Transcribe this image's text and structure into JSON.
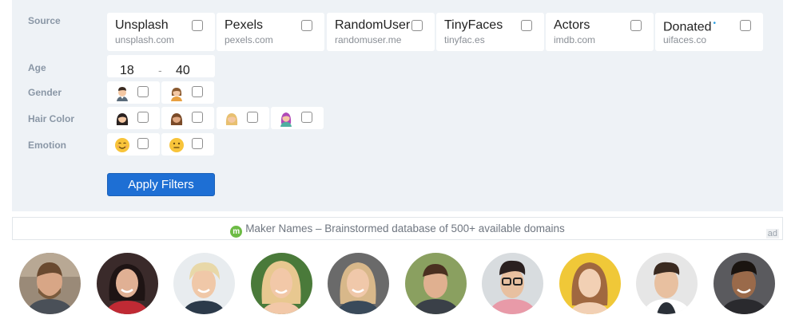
{
  "filters": {
    "source_label": "Source",
    "age_label": "Age",
    "gender_label": "Gender",
    "hair_label": "Hair Color",
    "emotion_label": "Emotion",
    "sources": [
      {
        "name": "Unsplash",
        "url": "unsplash.com"
      },
      {
        "name": "Pexels",
        "url": "pexels.com"
      },
      {
        "name": "RandomUser",
        "url": "randomuser.me"
      },
      {
        "name": "TinyFaces",
        "url": "tinyfac.es"
      },
      {
        "name": "Actors",
        "url": "imdb.com"
      },
      {
        "name": "Donated",
        "url": "uifaces.co",
        "dot": "•"
      }
    ],
    "age_min": "18",
    "age_separator": "-",
    "age_max": "40",
    "gender_options": [
      "male-icon",
      "female-icon"
    ],
    "hair_options": [
      "black-hair-icon",
      "brown-hair-icon",
      "blonde-hair-icon",
      "colored-hair-icon"
    ],
    "emotion_options": [
      "happy-face-icon",
      "neutral-face-icon"
    ],
    "apply_label": "Apply Filters"
  },
  "ad": {
    "logo_letter": "m",
    "text": "Maker Names – Brainstormed database of 500+ available domains",
    "tag": "ad"
  },
  "colors": {
    "panel_bg": "#eef2f6",
    "apply_bg": "#1e6fd4",
    "ad_logo": "#6dbb45"
  }
}
